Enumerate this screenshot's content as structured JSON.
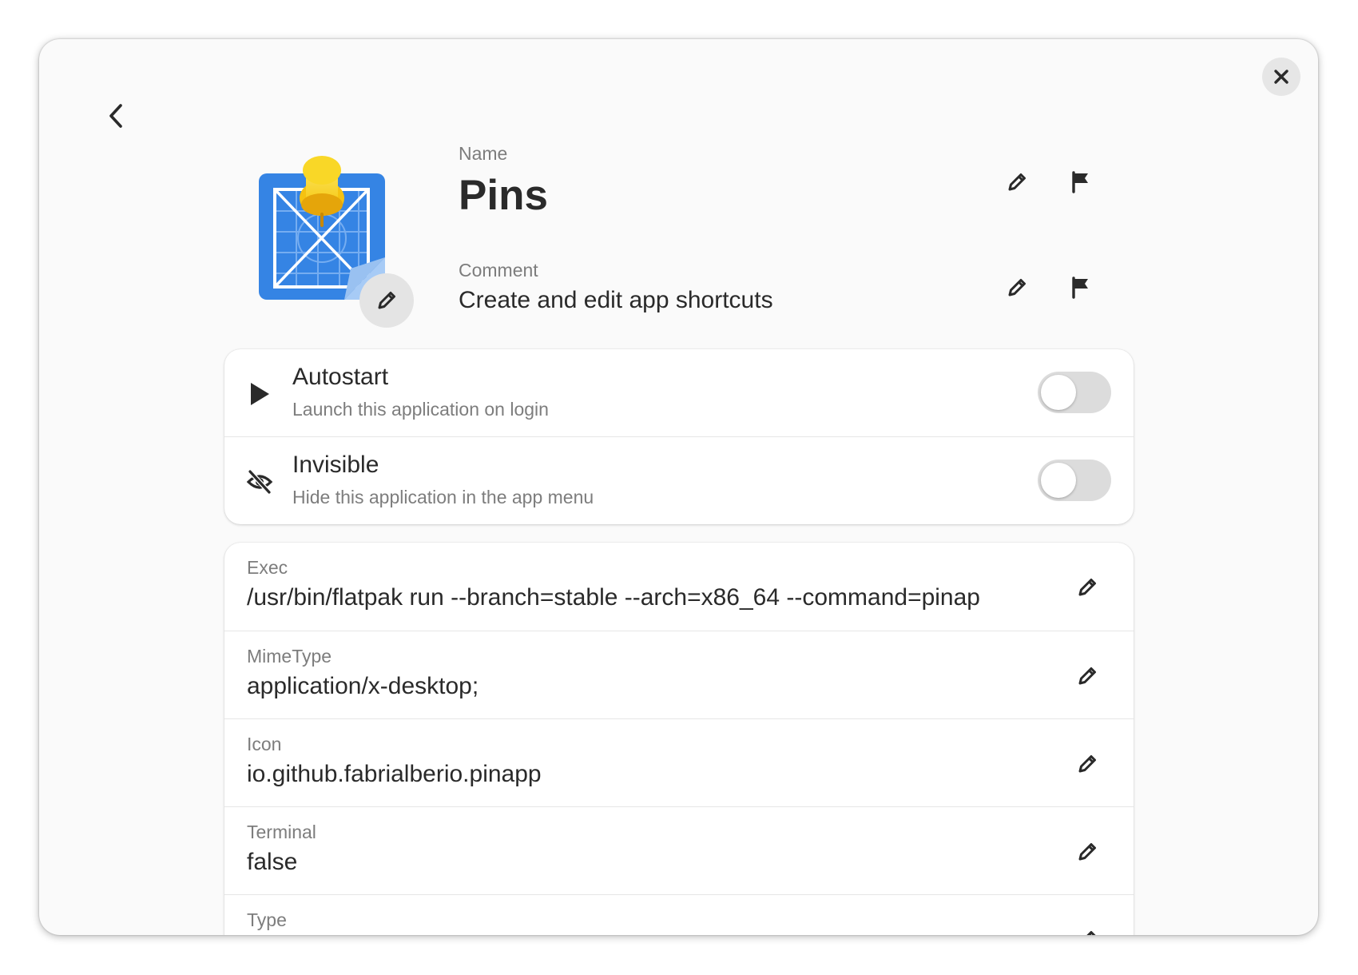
{
  "header": {
    "back_icon": "go-back-icon",
    "close_icon": "close-icon"
  },
  "app": {
    "icon_name": "pins-app-icon",
    "name_label": "Name",
    "name": "Pins",
    "comment_label": "Comment",
    "comment": "Create and edit app shortcuts"
  },
  "toggles": [
    {
      "title": "Autostart",
      "subtitle": "Launch this application on login",
      "icon": "play-icon",
      "on": false
    },
    {
      "title": "Invisible",
      "subtitle": "Hide this application in the app menu",
      "icon": "hidden-eye-icon",
      "on": false
    }
  ],
  "properties": [
    {
      "key": "Exec",
      "value": "/usr/bin/flatpak run --branch=stable --arch=x86_64 --command=pinap"
    },
    {
      "key": "MimeType",
      "value": "application/x-desktop;"
    },
    {
      "key": "Icon",
      "value": "io.github.fabrialberio.pinapp"
    },
    {
      "key": "Terminal",
      "value": "false"
    },
    {
      "key": "Type",
      "value": ""
    }
  ],
  "colors": {
    "window_bg": "#fafafa",
    "card_bg": "#ffffff",
    "text": "#2a2a2a",
    "dim_text": "#7d7d7d",
    "switch_off": "#dcdcdc"
  }
}
